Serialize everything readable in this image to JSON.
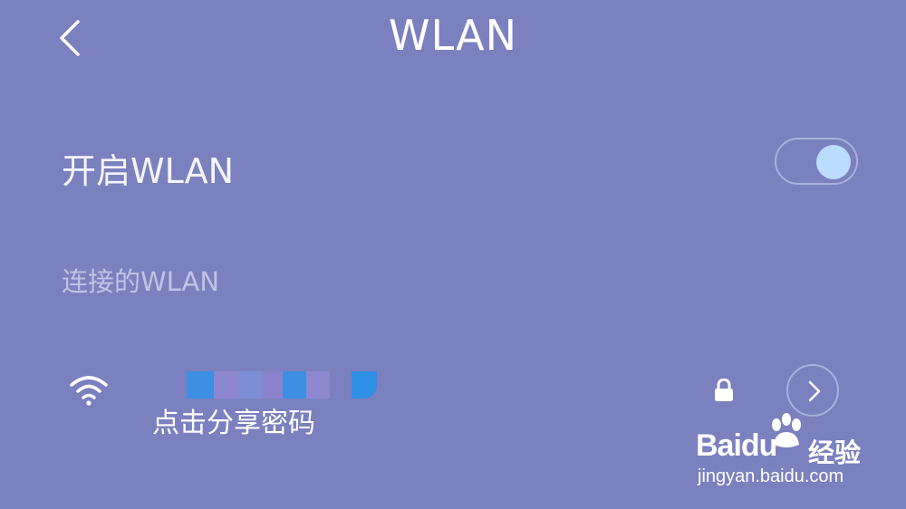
{
  "header": {
    "title": "WLAN",
    "back_icon": "chevron-left-icon"
  },
  "wlan_switch": {
    "label": "开启WLAN",
    "enabled": true,
    "knob_color": "#bcdcff"
  },
  "connected_section": {
    "label": "连接的WLAN"
  },
  "network": {
    "ssid_masked": true,
    "subtitle": "点击分享密码",
    "signal_icon": "wifi-icon",
    "secured_icon": "lock-icon",
    "detail_icon": "chevron-right-icon"
  },
  "watermark": {
    "logo": "Baidu",
    "brand_cn": "经验",
    "url": "jingyan.baidu.com"
  },
  "colors": {
    "background": "#7b80bf",
    "accent": "#bcdcff"
  }
}
